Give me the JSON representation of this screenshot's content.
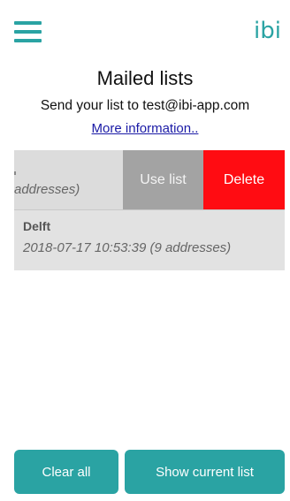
{
  "header": {
    "menu_icon": "hamburger-menu-icon",
    "logo_text": "ibi"
  },
  "main": {
    "title": "Mailed lists",
    "subtitle": "Send your list to test@ibi-app.com",
    "more_link": "More information.."
  },
  "list": {
    "swiped_item": {
      "visible_text": "addresses)",
      "use_label": "Use list",
      "delete_label": "Delete"
    },
    "items": [
      {
        "name": "Delft",
        "meta": "2018-07-17 10:53:39 (9 addresses)"
      }
    ]
  },
  "footer": {
    "clear_label": "Clear all",
    "show_label": "Show current list"
  },
  "colors": {
    "accent": "#2aa3a3",
    "delete": "#ff0c12",
    "use": "#a3a3a3",
    "link": "#1a1aa6"
  }
}
